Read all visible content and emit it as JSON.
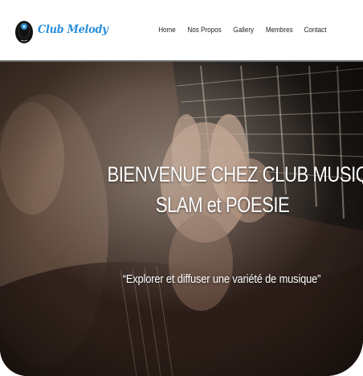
{
  "header": {
    "logo_text": "Club Melody",
    "logo_icon": "vinyl-record-icon",
    "nav": [
      {
        "label": "Home"
      },
      {
        "label": "Nos Propos"
      },
      {
        "label": "Gallery"
      },
      {
        "label": "Membres"
      },
      {
        "label": "Contact"
      }
    ]
  },
  "hero": {
    "title_line1": "BIENVENUE CHEZ CLUB MUSIQUE,",
    "title_line2": "SLAM et POESIE",
    "tagline": "“Explorer et diffuser une variété de musique”",
    "background_image": "guitar-playing-hand-photo"
  },
  "colors": {
    "brand": "#2a8fd6",
    "nav_text": "#222222",
    "divider": "#6e6e6e",
    "hero_text": "#ffffff"
  }
}
